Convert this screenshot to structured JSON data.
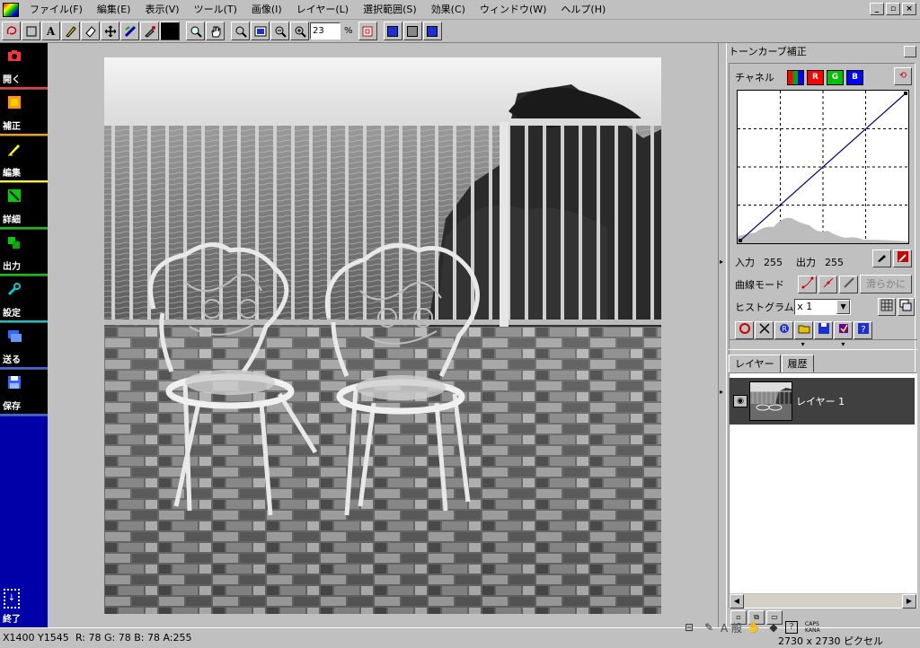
{
  "menu": {
    "items": [
      "ファイル(F)",
      "編集(E)",
      "表示(V)",
      "ツール(T)",
      "画像(I)",
      "レイヤー(L)",
      "選択範囲(S)",
      "効果(C)",
      "ウィンドウ(W)",
      "ヘルプ(H)"
    ]
  },
  "window_controls": [
    "_",
    "▫",
    "×"
  ],
  "toolbar": {
    "zoom_value": "23",
    "zoom_unit": "%"
  },
  "sidebar": {
    "items": [
      {
        "label": "開く",
        "icon": "camera-icon",
        "color": "#ff3333"
      },
      {
        "label": "補正",
        "icon": "adjust-icon",
        "color": "#ff9900"
      },
      {
        "label": "編集",
        "icon": "pencil-icon",
        "color": "#ffff00"
      },
      {
        "label": "詳細",
        "icon": "detail-icon",
        "color": "#00cc00"
      },
      {
        "label": "出力",
        "icon": "output-icon",
        "color": "#00cc00"
      },
      {
        "label": "設定",
        "icon": "wrench-icon",
        "color": "#00cccc"
      },
      {
        "label": "送る",
        "icon": "send-icon",
        "color": "#3366ff"
      },
      {
        "label": "保存",
        "icon": "floppy-icon",
        "color": "#3366ff"
      }
    ],
    "exit_label": "終了",
    "background": "#0000a8"
  },
  "tone_curve": {
    "title": "トーンカーブ補正",
    "channel_label": "チャネル",
    "channels": [
      "R",
      "G",
      "B"
    ],
    "input_label": "入力",
    "input_value": "255",
    "output_label": "出力",
    "output_value": "255",
    "curve_mode_label": "曲線モード",
    "smooth_label": "滑らかに",
    "histogram_label": "ヒストグラム",
    "histogram_scale": "x 1"
  },
  "layers": {
    "tabs": [
      "レイヤー",
      "履歴"
    ],
    "active_tab": "レイヤー",
    "items": [
      {
        "name": "レイヤー 1"
      }
    ]
  },
  "status": {
    "coords": "X1400 Y1545",
    "rgba": "R: 78 G: 78 B: 78 A:255",
    "ime_mode": "A 般",
    "caps": "CAPS",
    "kana": "KANA",
    "dims": "2730 x 2730 ピクセル"
  }
}
